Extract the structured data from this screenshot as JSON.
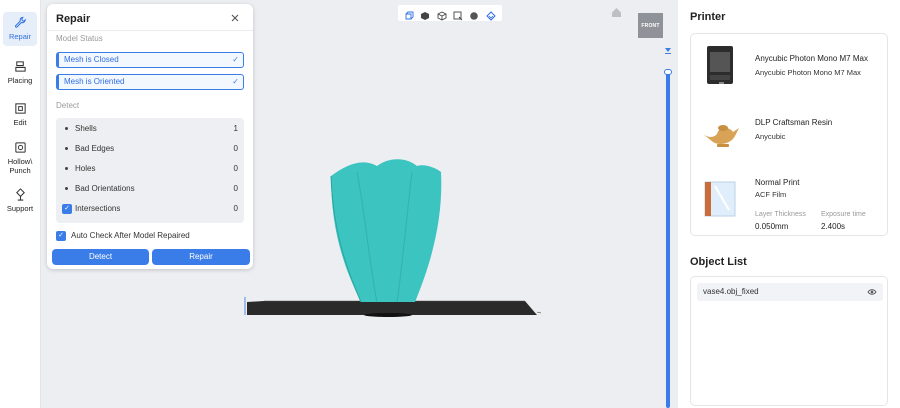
{
  "toolbar": {
    "tools": [
      {
        "label": "Repair",
        "icon": "wrench-icon",
        "active": true
      },
      {
        "label": "Placing",
        "icon": "placing-icon"
      },
      {
        "label": "Edit",
        "icon": "edit-icon"
      },
      {
        "label": "Hollow\\ Punch",
        "icon": "hollow-punch-icon"
      },
      {
        "label": "Support",
        "icon": "support-icon"
      }
    ]
  },
  "viewport": {
    "view_buttons": [
      "view-cube-icon",
      "view-solid-icon",
      "view-wire-icon",
      "view-select-icon",
      "view-sphere-icon",
      "view-layer-icon"
    ],
    "view_cube_label": "FRONT"
  },
  "repair_panel": {
    "title": "Repair",
    "model_status_label": "Model Status",
    "statuses": [
      "Mesh is Closed",
      "Mesh is Oriented"
    ],
    "detect_label": "Detect",
    "detect_rows": [
      {
        "name": "Shells",
        "value": "1"
      },
      {
        "name": "Bad Edges",
        "value": "0"
      },
      {
        "name": "Holes",
        "value": "0"
      },
      {
        "name": "Bad Orientations",
        "value": "0"
      },
      {
        "name": "Intersections",
        "value": "0"
      }
    ],
    "auto_check_label": "Auto Check After Model Repaired",
    "detect_button": "Detect",
    "repair_button": "Repair"
  },
  "printer_panel": {
    "title": "Printer",
    "printer_name": "Anycubic Photon Mono M7 Max",
    "printer_model": "Anycubic Photon Mono M7 Max",
    "resin_name": "DLP Craftsman Resin",
    "resin_brand": "Anycubic",
    "profile_name": "Normal Print",
    "film": "ACF Film",
    "layer_thickness_label": "Layer Thickness",
    "layer_thickness": "0.050mm",
    "exposure_label": "Exposure time",
    "exposure": "2.400s"
  },
  "object_list": {
    "title": "Object List",
    "objects": [
      "vase4.obj_fixed"
    ]
  },
  "colors": {
    "accent": "#3b7de8",
    "model": "#3cc4c0",
    "plate": "#2a2a2a"
  }
}
